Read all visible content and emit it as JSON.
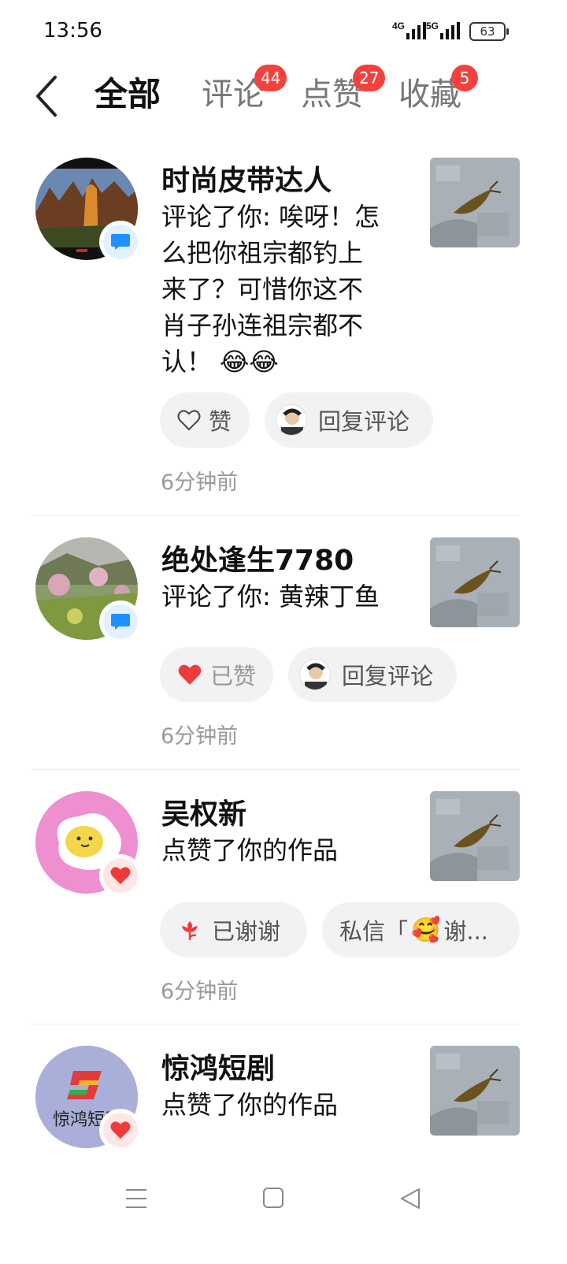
{
  "status": {
    "time": "13:56",
    "net1": "4G",
    "net2": "5G",
    "battery": "63"
  },
  "tabs": [
    {
      "label": "全部"
    },
    {
      "label": "评论",
      "badge": "44"
    },
    {
      "label": "点赞",
      "badge": "27"
    },
    {
      "label": "收藏",
      "badge": "5"
    }
  ],
  "items": [
    {
      "name": "时尚皮带达人",
      "lines": [
        "评论了你: 唉呀！怎",
        "么把你祖宗都钓上",
        "来了？可惜你这不",
        "肖子孙连祖宗都不",
        "认！"
      ],
      "emoji": "😂😂",
      "type": "comment-icon",
      "like_label": "赞",
      "reply_label": "回复评论",
      "time": "6分钟前"
    },
    {
      "name": "绝处逢生7780",
      "lines": [
        "评论了你: 黄辣丁鱼"
      ],
      "type": "comment-icon",
      "like_label": "已赞",
      "reply_label": "回复评论",
      "time": "6分钟前"
    },
    {
      "name": "吴权新",
      "lines": [
        "点赞了你的作品"
      ],
      "type": "heart-icon",
      "thanks_label": "已谢谢",
      "dm_label_prefix": "私信「",
      "dm_label_suffix": "谢...",
      "time": "6分钟前"
    },
    {
      "name": "惊鸿短剧",
      "lines": [
        "点赞了你的作品"
      ],
      "type": "heart-icon",
      "avatar_text": "惊鸿短剧"
    }
  ],
  "colors": {
    "badge": "#f5413d",
    "comment_blue": "#1e90ff",
    "like_red": "#f03a3a",
    "pill_bg": "#f2f2f4"
  }
}
